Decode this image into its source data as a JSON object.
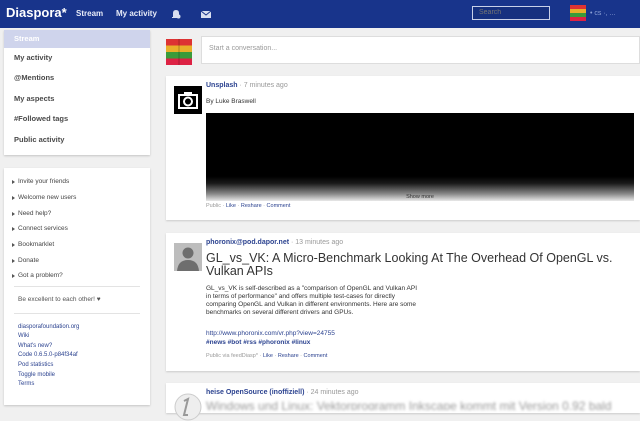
{
  "header": {
    "brand": "Diaspora*",
    "nav": [
      "Stream",
      "My activity"
    ],
    "search_placeholder": "Search",
    "user_name": "• cs ·, ...",
    "icons": [
      "bell-icon",
      "mail-icon"
    ]
  },
  "sidebar": {
    "items": [
      {
        "label": "Stream",
        "active": true
      },
      {
        "label": "My activity"
      },
      {
        "label": "@Mentions"
      },
      {
        "label": "My aspects"
      },
      {
        "label": "#Followed tags"
      },
      {
        "label": "Public activity"
      }
    ],
    "links": [
      "Invite your friends",
      "Welcome new users",
      "Need help?",
      "Connect services",
      "Bookmarklet",
      "Donate",
      "Got a problem?"
    ],
    "tagline": "Be excellent to each other! ♥",
    "footer": [
      "diasporafoundation.org",
      "Wiki",
      "What's new?",
      "Code 0.6.5.0-p84f34af",
      "Pod statistics",
      "Toggle mobile",
      "Terms"
    ]
  },
  "publisher": {
    "placeholder": "Start a conversation..."
  },
  "posts": [
    {
      "author": "Unsplash",
      "time": " · 7 minutes ago",
      "byline": "By Luke Braswell",
      "show_more": "Show more",
      "meta_prefix": "Public ·",
      "like": "Like",
      "reshare": "Reshare",
      "comment": "Comment"
    },
    {
      "author": "phoronix@pod.dapor.net",
      "time": " · 13 minutes ago",
      "headline": "GL_vs_VK: A Micro-Benchmark Looking At The Overhead Of OpenGL vs. Vulkan APIs",
      "body": [
        "GL_vs_VK is self-described as a \"comparison of OpenGL and Vulkan API",
        "in terms of performance\" and offers multiple test-cases for directly",
        "comparing OpenGL and Vulkan in different environments. Here are some",
        "benchmarks on several different drivers and GPUs."
      ],
      "url": "http://www.phoronix.com/vr.php?view=24755",
      "tags": "#news #bot #rss #phoronix #linux",
      "meta_prefix": "Public via feedDiasp* ·",
      "like": "Like",
      "reshare": "Reshare",
      "comment": "Comment"
    },
    {
      "author": "heise OpenSource (inoffiziell)",
      "time": " · 24 minutes ago",
      "blurred_title": "Windows und Linux: Vektorprogramm Inkscape kommt mit Version 0.92 bald"
    }
  ],
  "colors": {
    "topbar": "#18348b",
    "link": "#2c4390",
    "active_nav": "#cfd4ec",
    "background": "#f0f0f0"
  }
}
